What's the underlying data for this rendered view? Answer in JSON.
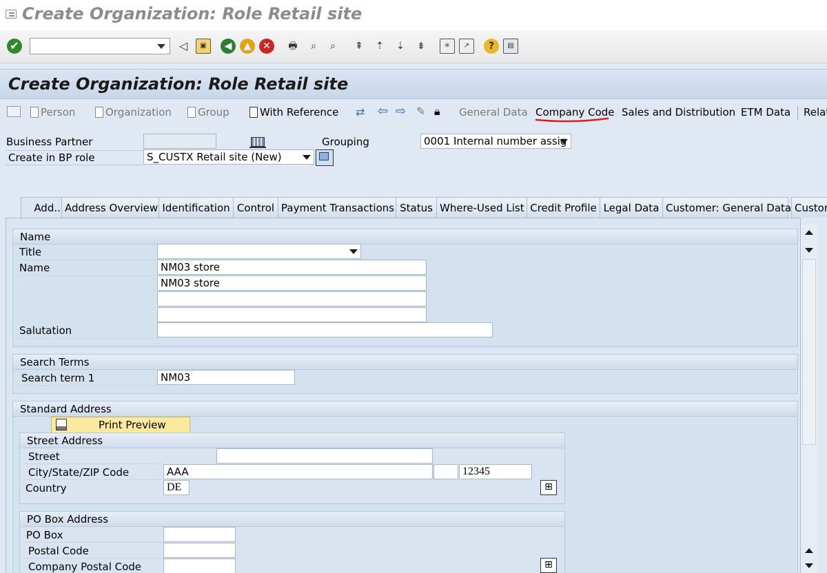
{
  "window": {
    "title": "Create Organization: Role Retail site"
  },
  "app_title": "Create Organization: Role Retail site",
  "toolbar": {
    "items": [
      "Person",
      "Organization",
      "Group",
      "With Reference",
      "General Data",
      "Company Code",
      "Sales and Distribution",
      "ETM Data",
      "Relat"
    ]
  },
  "header": {
    "bp_label": "Business Partner",
    "bp_value": "",
    "grouping_label": "Grouping",
    "grouping_value": "0001 Internal number assig",
    "role_label": "Create in BP role",
    "role_value": "S_CUSTX Retail site (New)"
  },
  "tabs": [
    "Add...",
    "Address Overview",
    "Identification",
    "Control",
    "Payment Transactions",
    "Status",
    "Where-Used List",
    "Credit Profile",
    "Legal Data",
    "Customer: General Data",
    "Custon"
  ],
  "name_group": {
    "title": "Name",
    "title_label": "Title",
    "title_value": "",
    "name_label": "Name",
    "name1": "NM03 store",
    "name2": "NM03 store",
    "name3": "",
    "name4": "",
    "salutation_label": "Salutation",
    "salutation_value": ""
  },
  "search_group": {
    "title": "Search Terms",
    "term1_label": "Search term 1",
    "term1_value": "NM03"
  },
  "address_group": {
    "title": "Standard Address",
    "print_preview": "Print Preview",
    "street_title": "Street Address",
    "street_label": "Street",
    "street_value": "",
    "city_label": "City/State/ZIP Code",
    "city_value": "AAA",
    "state_value": "",
    "zip_value": "12345",
    "country_label": "Country",
    "country_value": "DE",
    "pobox_title": "PO Box Address",
    "pobox_label": "PO Box",
    "pobox_value": "",
    "postal_label": "Postal Code",
    "postal_value": "",
    "company_postal_label": "Company Postal Code",
    "company_postal_value": ""
  },
  "colors": {
    "annotation_underline": "#d61f1f",
    "preview_button": "#fbe9a0",
    "panel": "#d4e1ef"
  }
}
